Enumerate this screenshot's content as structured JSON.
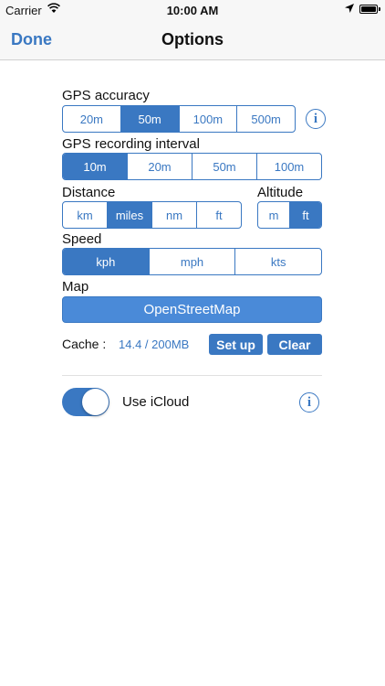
{
  "status_bar": {
    "carrier": "Carrier",
    "time": "10:00 AM"
  },
  "nav": {
    "done": "Done",
    "title": "Options"
  },
  "gps_accuracy": {
    "label": "GPS accuracy",
    "options": [
      "20m",
      "50m",
      "100m",
      "500m"
    ],
    "selected": "50m"
  },
  "gps_interval": {
    "label": "GPS recording interval",
    "options": [
      "10m",
      "20m",
      "50m",
      "100m"
    ],
    "selected": "10m"
  },
  "distance": {
    "label": "Distance",
    "options": [
      "km",
      "miles",
      "nm",
      "ft"
    ],
    "selected": "miles"
  },
  "altitude": {
    "label": "Altitude",
    "options": [
      "m",
      "ft"
    ],
    "selected": "ft"
  },
  "speed": {
    "label": "Speed",
    "options": [
      "kph",
      "mph",
      "kts"
    ],
    "selected": "kph"
  },
  "map": {
    "label": "Map",
    "button": "OpenStreetMap"
  },
  "cache": {
    "label": "Cache :",
    "value": "14.4 / 200MB",
    "setup": "Set up",
    "clear": "Clear"
  },
  "icloud": {
    "label": "Use iCloud",
    "enabled": true
  },
  "info_glyph": "i",
  "colors": {
    "accent": "#3a78c2",
    "map_button": "#4a8ad8"
  }
}
